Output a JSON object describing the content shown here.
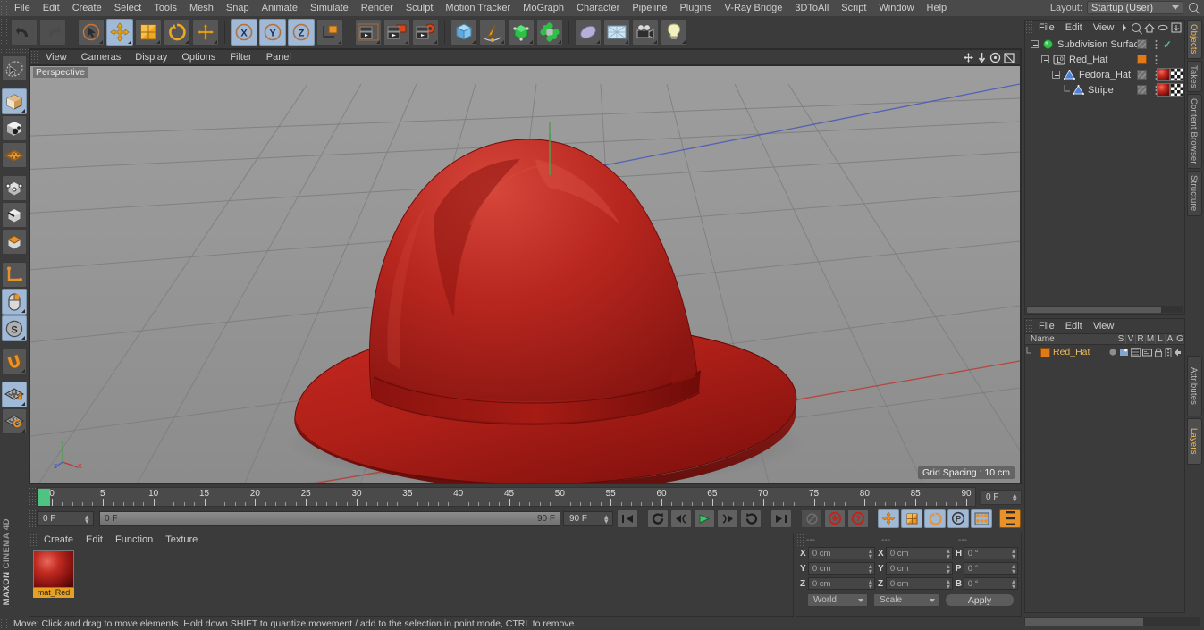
{
  "menubar": {
    "items": [
      "File",
      "Edit",
      "Create",
      "Select",
      "Tools",
      "Mesh",
      "Snap",
      "Animate",
      "Simulate",
      "Render",
      "Sculpt",
      "Motion Tracker",
      "MoGraph",
      "Character",
      "Pipeline",
      "Plugins",
      "V-Ray Bridge",
      "3DToAll",
      "Script",
      "Window",
      "Help"
    ],
    "layout_label": "Layout:",
    "layout_value": "Startup (User)",
    "search_icon": "search-icon"
  },
  "viewport": {
    "menu": [
      "View",
      "Cameras",
      "Display",
      "Options",
      "Filter",
      "Panel"
    ],
    "camera_label": "Perspective",
    "grid_spacing": "Grid Spacing : 10 cm",
    "axis_labels": [
      "Y",
      "X",
      "Z"
    ],
    "model_description": "Red fedora hat 3D model",
    "colors": {
      "hat_main": "#b3241f",
      "hat_shadow": "#7b120f",
      "hat_light": "#d84438",
      "grid": "#7f7f7f",
      "background_top": "#9a9a9a",
      "background_bottom": "#8e8e8e",
      "axis_x": "#c0392b",
      "axis_y": "#3f8f3f",
      "axis_z": "#3b4fa8"
    }
  },
  "timeline": {
    "labels": [
      "0",
      "5",
      "10",
      "15",
      "20",
      "25",
      "30",
      "35",
      "40",
      "45",
      "50",
      "55",
      "60",
      "65",
      "70",
      "75",
      "80",
      "85",
      "90"
    ],
    "current_frame_field": "0 F",
    "start": 0,
    "end": 90
  },
  "transport": {
    "frame_field": "0 F",
    "range_start": "0 F",
    "range_end": "90 F",
    "end_field": "90 F",
    "buttons": [
      {
        "name": "go-to-start-button",
        "glyph": "|◀◀"
      },
      {
        "name": "play-backwards-loop-button",
        "glyph": "↺"
      },
      {
        "name": "previous-key-button",
        "glyph": "◀("
      },
      {
        "name": "play-button",
        "glyph": "▶"
      },
      {
        "name": "next-key-button",
        "glyph": ")▶"
      },
      {
        "name": "play-forwards-loop-button",
        "glyph": "↻"
      },
      {
        "name": "go-to-end-button",
        "glyph": "▶▶|"
      },
      {
        "name": "record-disabled-button",
        "glyph": "⊘"
      },
      {
        "name": "record-active-object-button",
        "glyph": "●"
      },
      {
        "name": "autokeying-button",
        "glyph": "?"
      },
      {
        "name": "position-key-button",
        "glyph": "✚"
      },
      {
        "name": "scale-key-button",
        "glyph": "▣"
      },
      {
        "name": "rotation-key-button",
        "glyph": "◌"
      },
      {
        "name": "parameter-key-button",
        "glyph": "P"
      },
      {
        "name": "point-level-animation-button",
        "glyph": "⠿"
      },
      {
        "name": "timeline-toggle-button",
        "glyph": "‖"
      }
    ]
  },
  "material_manager": {
    "menu": [
      "Create",
      "Edit",
      "Function",
      "Texture"
    ],
    "materials": [
      {
        "name": "mat_Red",
        "color": "#b3241f"
      }
    ]
  },
  "coordinates": {
    "header_cols": [
      "---",
      "---",
      "---"
    ],
    "rows": [
      {
        "axis": "X",
        "position": "0 cm",
        "axis2": "X",
        "size": "0 cm",
        "rot_label": "H",
        "rotation": "0 °"
      },
      {
        "axis": "Y",
        "position": "0 cm",
        "axis2": "Y",
        "size": "0 cm",
        "rot_label": "P",
        "rotation": "0 °"
      },
      {
        "axis": "Z",
        "position": "0 cm",
        "axis2": "Z",
        "size": "0 cm",
        "rot_label": "B",
        "rotation": "0 °"
      }
    ],
    "coordinate_system": "World",
    "size_mode": "Scale",
    "apply_label": "Apply"
  },
  "object_manager": {
    "menu": [
      "File",
      "Edit",
      "View"
    ],
    "tree": [
      {
        "label": "Subdivision Surface",
        "depth": 0,
        "icon": "subdivision-surface-icon",
        "has_check": true,
        "has_gray_tag": true
      },
      {
        "label": "Red_Hat",
        "depth": 1,
        "icon": "layer-zero-icon",
        "has_orange_swatch": true
      },
      {
        "label": "Fedora_Hat",
        "depth": 2,
        "icon": "polygon-object-icon",
        "has_gray_tag": true,
        "has_material_tag": true
      },
      {
        "label": "Stripe",
        "depth": 3,
        "icon": "polygon-object-icon",
        "has_gray_tag": true,
        "has_material_tag": true
      }
    ]
  },
  "attributes_manager": {
    "menu": [
      "File",
      "Edit",
      "View"
    ],
    "columns": [
      "Name",
      "S",
      "V",
      "R",
      "M",
      "L",
      "A",
      "G"
    ],
    "rows": [
      {
        "name": "Red_Hat",
        "color": "#e07a18"
      }
    ]
  },
  "right_tabs_top": [
    "Objects",
    "Takes",
    "Content Browser",
    "Structure"
  ],
  "right_tabs_bottom": [
    "Attributes",
    "Layers"
  ],
  "statusbar": {
    "message": "Move: Click and drag to move elements. Hold down SHIFT to quantize movement / add to the selection in point mode, CTRL to remove."
  },
  "left_toolbar": [
    {
      "name": "live-selection-tool",
      "icon": "lasso-icon",
      "active": false
    },
    {
      "name": "model-mode-button",
      "icon": "cube-model-icon",
      "active": true
    },
    {
      "name": "object-axis-mode-button",
      "icon": "cube-axis-icon",
      "active": false
    },
    {
      "name": "texture-axis-mode-button",
      "icon": "texture-grid-icon",
      "active": false
    },
    {
      "name": "point-mode-button",
      "icon": "cube-points-icon",
      "active": false
    },
    {
      "name": "edge-mode-button",
      "icon": "cube-edges-icon",
      "active": false
    },
    {
      "name": "polygon-mode-button",
      "icon": "cube-polygon-icon",
      "active": false
    },
    {
      "name": "enable-axis-button",
      "icon": "axis-corner-icon",
      "active": false
    },
    {
      "name": "viewport-solo-button",
      "icon": "mouse-icon",
      "active": true
    },
    {
      "name": "soft-selection-button",
      "icon": "s-circle-icon",
      "active": true
    },
    {
      "name": "snap-button",
      "icon": "magnet-icon",
      "active": false
    },
    {
      "name": "workplane-lock-button",
      "icon": "grid-lock-icon",
      "active": true
    },
    {
      "name": "workplane-rotate-button",
      "icon": "grid-rotate-icon",
      "active": false
    }
  ],
  "top_toolbar": [
    {
      "name": "undo-button",
      "icon": "undo-arrow-icon",
      "active": false
    },
    {
      "name": "redo-button",
      "icon": "redo-arrow-icon",
      "active": false
    },
    {
      "name": "select-tool-button",
      "icon": "cursor-circle-icon",
      "active": false
    },
    {
      "name": "move-tool-button",
      "icon": "move-arrows-icon",
      "active": true
    },
    {
      "name": "scale-tool-button",
      "icon": "scale-square-icon",
      "active": false
    },
    {
      "name": "rotate-tool-button",
      "icon": "rotate-circle-icon",
      "active": false
    },
    {
      "name": "world-axis-button",
      "icon": "move-plus-icon",
      "active": false
    },
    {
      "name": "x-axis-lock-button",
      "icon": "x-axis-icon",
      "active": true
    },
    {
      "name": "y-axis-lock-button",
      "icon": "y-axis-icon",
      "active": true
    },
    {
      "name": "z-axis-lock-button",
      "icon": "z-axis-icon",
      "active": true
    },
    {
      "name": "coordinate-system-button",
      "icon": "world-object-axis-icon",
      "active": false
    },
    {
      "name": "render-view-button",
      "icon": "render-clapper-icon",
      "active": false
    },
    {
      "name": "render-region-button",
      "icon": "render-region-icon",
      "active": false
    },
    {
      "name": "render-settings-button",
      "icon": "render-settings-icon",
      "active": false
    },
    {
      "name": "add-cube-button",
      "icon": "cube-primitive-icon",
      "active": false
    },
    {
      "name": "add-spline-button",
      "icon": "pen-spline-icon",
      "active": false
    },
    {
      "name": "add-generator-button",
      "icon": "green-cube-icon",
      "active": false
    },
    {
      "name": "add-deformer-button",
      "icon": "green-cluster-icon",
      "active": false
    },
    {
      "name": "add-scene-object-button",
      "icon": "blob-icon",
      "active": false
    },
    {
      "name": "add-environment-button",
      "icon": "sky-grid-icon",
      "active": false
    },
    {
      "name": "add-camera-button",
      "icon": "camera-icon",
      "active": false
    },
    {
      "name": "add-light-button",
      "icon": "lightbulb-icon",
      "active": false
    }
  ],
  "maxon_logo": [
    "MAXON",
    "CINEMA 4D"
  ]
}
